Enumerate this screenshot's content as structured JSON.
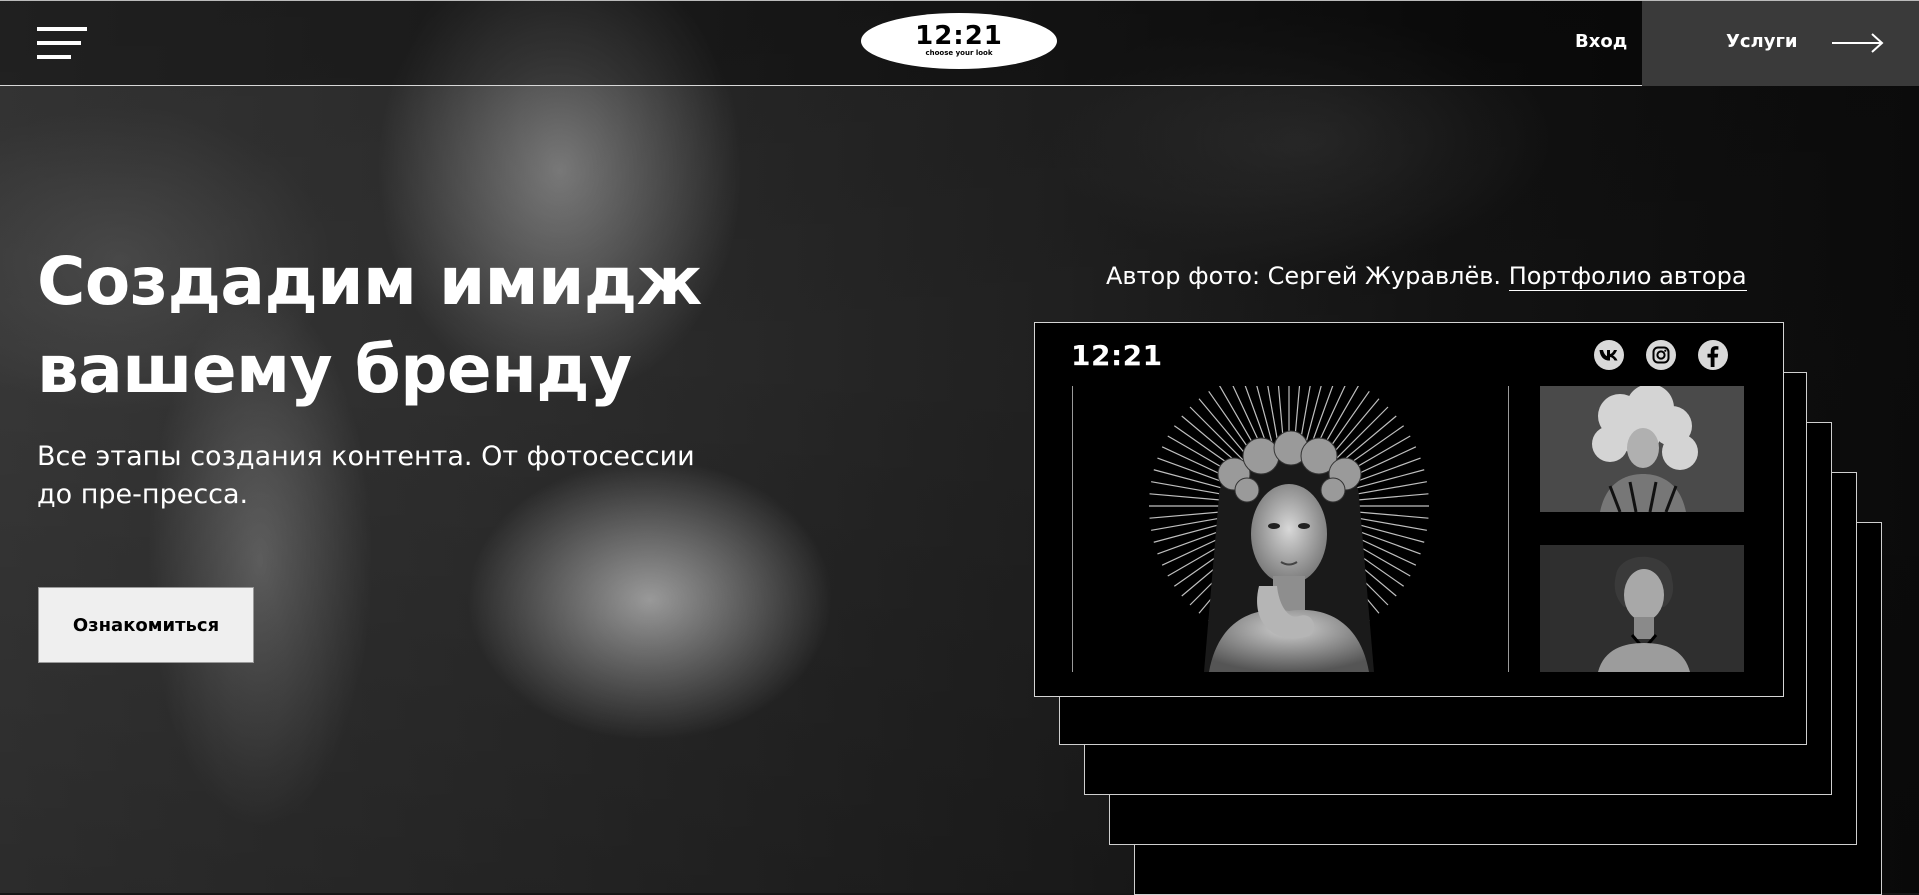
{
  "header": {
    "logo_big": "12:21",
    "logo_small": "choose your look",
    "login_label": "Вход",
    "services_label": "Услуги"
  },
  "hero": {
    "title_line1": "Создадим имидж",
    "title_line2": "вашему бренду",
    "subtitle_line1": "Все этапы создания контента. От фотосессии",
    "subtitle_line2": "до пре-пресса.",
    "cta_label": "Ознакомиться"
  },
  "credit": {
    "text": "Автор фото: Сергей Журавлёв.",
    "link_label": "Портфолио автора"
  },
  "card": {
    "logo": "12:21",
    "socials": [
      "vk-icon",
      "instagram-icon",
      "facebook-icon"
    ]
  },
  "colors": {
    "background": "#161616",
    "button_bg": "#efefef",
    "services_bg": "#3a3a3a",
    "card_bg": "#000000"
  }
}
